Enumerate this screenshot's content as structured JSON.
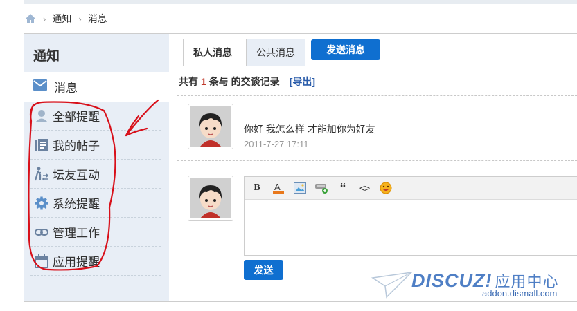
{
  "breadcrumb": {
    "items": [
      "通知",
      "消息"
    ]
  },
  "sidebar": {
    "title": "通知",
    "active_item": {
      "label": "消息",
      "icon": "envelope-icon"
    },
    "items": [
      {
        "label": "全部提醒",
        "icon": "user-icon"
      },
      {
        "label": "我的帖子",
        "icon": "posts-icon"
      },
      {
        "label": "坛友互动",
        "icon": "interaction-icon"
      },
      {
        "label": "系统提醒",
        "icon": "gear-icon"
      },
      {
        "label": "管理工作",
        "icon": "link-icon"
      },
      {
        "label": "应用提醒",
        "icon": "calendar-icon"
      }
    ]
  },
  "tabs": [
    {
      "label": "私人消息",
      "active": true
    },
    {
      "label": "公共消息",
      "active": false
    }
  ],
  "send_message_button": "发送消息",
  "summary": {
    "prefix": "共有",
    "count": "1",
    "suffix": "条与 的交谈记录",
    "export_label": "[导出]"
  },
  "message": {
    "text": "你好 我怎么样 才能加你为好友",
    "time": "2011-7-27 17:11"
  },
  "editor": {
    "toolbar": [
      "bold-icon",
      "font-color-icon",
      "image-icon",
      "attachment-icon",
      "quote-icon",
      "code-icon",
      "smiley-icon"
    ],
    "bold_label": "B",
    "font_color_label": "A",
    "quote_label": "“",
    "code_label": "<>"
  },
  "send_button": "发送",
  "watermark": {
    "brand": "DISCUZ!",
    "brand_cn": "应用中心",
    "url": "addon.dismall.com"
  },
  "colors": {
    "accent": "#0f6fd0",
    "sidebar_bg": "#e8eef6",
    "highlight": "#c0392b",
    "annotation": "#d8101a"
  }
}
